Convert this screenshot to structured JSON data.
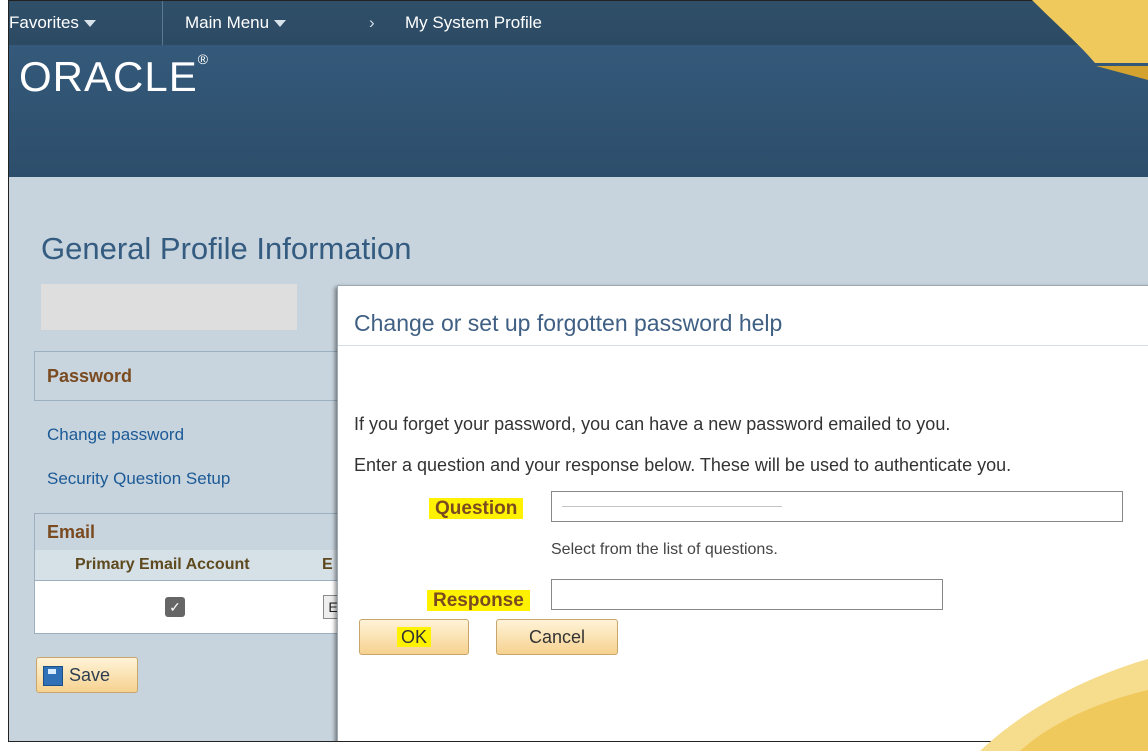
{
  "nav": {
    "favorites": "Favorites",
    "main_menu": "Main Menu",
    "breadcrumb_sep": "›",
    "breadcrumb": "My System Profile"
  },
  "brand": {
    "logo": "ORACLE",
    "logo_mark": "®"
  },
  "page": {
    "title": "General Profile Information"
  },
  "password_section": {
    "title": "Password",
    "links": [
      "Change password",
      "Security Question Setup"
    ]
  },
  "email_section": {
    "title": "Email",
    "columns": [
      "Primary Email Account",
      "E"
    ],
    "row": {
      "checked": "✓",
      "button": "E"
    }
  },
  "actions": {
    "save_label": "Save"
  },
  "dialog": {
    "title": "Change or set up forgotten password help",
    "line1": "If you forget your password, you can have a new password emailed to you.",
    "line2": "Enter a question and your response below. These will be used to authenticate you.",
    "question_label": "Question",
    "question_hint": "Select from the list of questions.",
    "response_label": "Response",
    "ok_label": "OK",
    "cancel_label": "Cancel"
  },
  "colors": {
    "navy": "#2d4a63",
    "panel": "#c7d3dd",
    "title_blue": "#345b80",
    "label_brown": "#7a4a21",
    "highlight": "#fff200",
    "circle": "#e00000",
    "deco_gold": "#f0c95c"
  },
  "icons": {
    "favorites_caret": "caret-down-icon",
    "main_menu_caret": "caret-down-icon",
    "save": "save-disk-icon",
    "question_dropdown": "chevron-down-icon",
    "email_checkbox": "checkbox-checked-icon"
  }
}
